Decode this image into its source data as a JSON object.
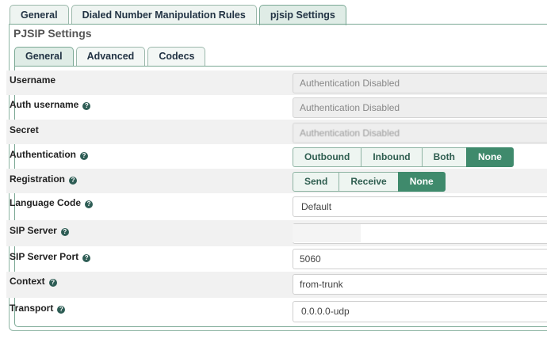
{
  "top_tabs": [
    "General",
    "Dialed Number Manipulation Rules",
    "pjsip Settings"
  ],
  "panel_title": "PJSIP Settings",
  "inner_tabs": [
    "General",
    "Advanced",
    "Codecs"
  ],
  "help_glyph": "?",
  "fields": {
    "username": {
      "label": "Username",
      "value": "Authentication Disabled"
    },
    "auth_username": {
      "label": "Auth username",
      "value": "Authentication Disabled"
    },
    "secret": {
      "label": "Secret",
      "value": "Authentication Disabled"
    },
    "authentication": {
      "label": "Authentication",
      "options": [
        "Outbound",
        "Inbound",
        "Both",
        "None"
      ],
      "selected": "None"
    },
    "registration": {
      "label": "Registration",
      "options": [
        "Send",
        "Receive",
        "None"
      ],
      "selected": "None"
    },
    "language_code": {
      "label": "Language Code",
      "value": "Default"
    },
    "sip_server": {
      "label": "SIP Server",
      "value": ""
    },
    "sip_server_port": {
      "label": "SIP Server Port",
      "value": "5060"
    },
    "context": {
      "label": "Context",
      "value": "from-trunk"
    },
    "transport": {
      "label": "Transport",
      "value": "0.0.0.0-udp"
    }
  },
  "colors": {
    "accent": "#3f8a6c",
    "tab_border": "#7aa894",
    "row_shade": "#f1f1f1"
  }
}
